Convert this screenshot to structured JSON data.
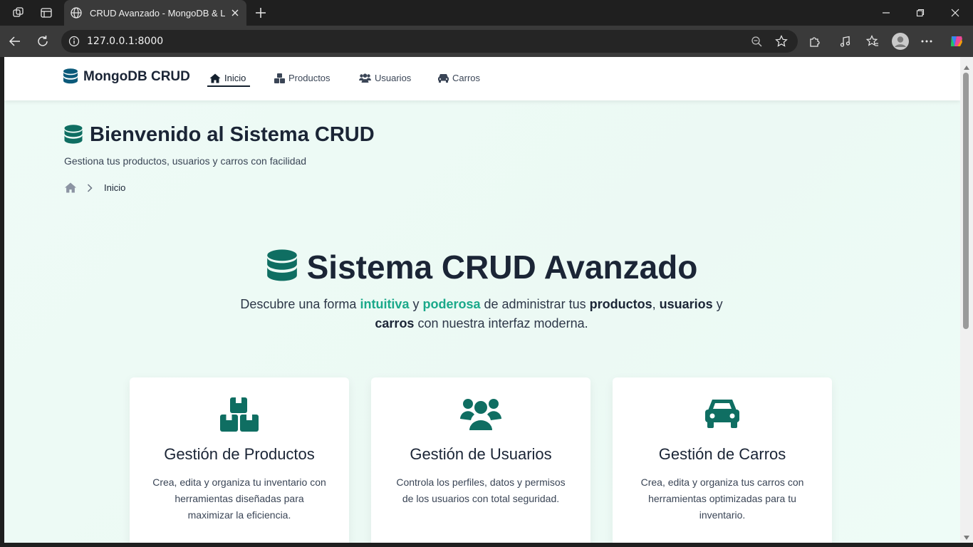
{
  "browser": {
    "tab_title": "CRUD Avanzado - MongoDB & La",
    "url": "127.0.0.1:8000"
  },
  "navbar": {
    "brand": "MongoDB CRUD",
    "items": [
      {
        "label": "Inicio",
        "icon": "home-icon",
        "active": true
      },
      {
        "label": "Productos",
        "icon": "boxes-icon"
      },
      {
        "label": "Usuarios",
        "icon": "users-icon"
      },
      {
        "label": "Carros",
        "icon": "car-icon"
      }
    ]
  },
  "header": {
    "title": "Bienvenido al Sistema CRUD",
    "subtitle": "Gestiona tus productos, usuarios y carros con facilidad",
    "breadcrumb_current": "Inicio"
  },
  "hero": {
    "title": "Sistema CRUD Avanzado",
    "desc_1": "Descubre una forma ",
    "desc_hl1": "intuitiva",
    "desc_2": " y ",
    "desc_hl2": "poderosa",
    "desc_3": " de administrar tus ",
    "desc_b1": "productos",
    "desc_4": ", ",
    "desc_b2": "usuarios",
    "desc_5": " y ",
    "desc_b3": "carros",
    "desc_6": " con nuestra interfaz moderna."
  },
  "cards": [
    {
      "title": "Gestión de Productos",
      "text": "Crea, edita y organiza tu inventario con herramientas diseñadas para maximizar la eficiencia.",
      "icon": "boxes-icon"
    },
    {
      "title": "Gestión de Usuarios",
      "text": "Controla los perfiles, datos y permisos de los usuarios con total seguridad.",
      "icon": "users-icon"
    },
    {
      "title": "Gestión de Carros",
      "text": "Crea, edita y organiza tus carros con herramientas optimizadas para tu inventario.",
      "icon": "car-icon"
    }
  ],
  "colors": {
    "brand_dark": "#0b5a7a",
    "accent": "#0f6e62",
    "highlight": "#1aa98a",
    "text_dark": "#1b2536"
  }
}
